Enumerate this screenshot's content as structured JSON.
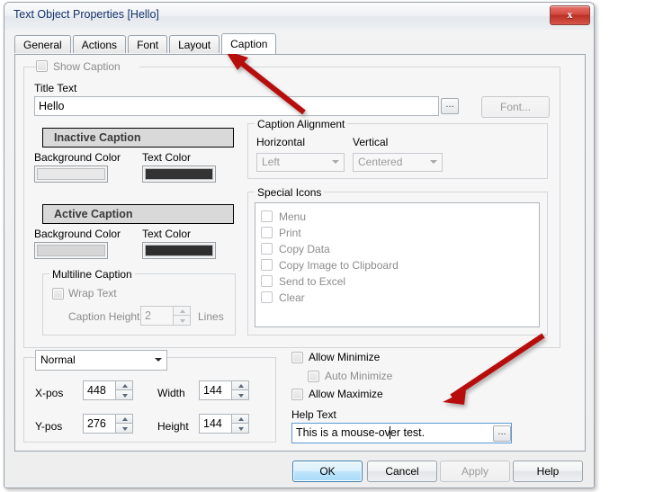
{
  "window": {
    "title": "Text Object Properties [Hello]",
    "close_label": "x"
  },
  "tabs": [
    {
      "label": "General",
      "active": false
    },
    {
      "label": "Actions",
      "active": false
    },
    {
      "label": "Font",
      "active": false
    },
    {
      "label": "Layout",
      "active": false
    },
    {
      "label": "Caption",
      "active": true
    }
  ],
  "caption_tab": {
    "show_caption": {
      "label": "Show Caption",
      "checked": false,
      "enabled": false
    },
    "title_text": {
      "label": "Title Text",
      "value": "Hello",
      "browse_label": "..."
    },
    "font_button": {
      "label": "Font...",
      "enabled": false
    },
    "inactive_caption": {
      "preview_text": "Inactive Caption",
      "background_label": "Background Color",
      "text_label": "Text Color",
      "background_color": "#e8e8e8",
      "text_color": "#333333"
    },
    "active_caption": {
      "preview_text": "Active Caption",
      "background_label": "Background Color",
      "text_label": "Text Color",
      "background_color": "#d6d6d6",
      "text_color": "#2e2e2e"
    },
    "multiline": {
      "legend": "Multiline Caption",
      "wrap_text_label": "Wrap Text",
      "wrap_text_checked": false,
      "caption_height_label": "Caption Height",
      "caption_height_value": "2",
      "lines_label": "Lines"
    },
    "alignment": {
      "legend": "Caption Alignment",
      "horizontal_label": "Horizontal",
      "horizontal_value": "Left",
      "vertical_label": "Vertical",
      "vertical_value": "Centered"
    },
    "special_icons": {
      "legend": "Special Icons",
      "items": [
        {
          "label": "Menu",
          "checked": false
        },
        {
          "label": "Print",
          "checked": false
        },
        {
          "label": "Copy Data",
          "checked": false
        },
        {
          "label": "Copy Image to Clipboard",
          "checked": false
        },
        {
          "label": "Send to Excel",
          "checked": false
        },
        {
          "label": "Clear",
          "checked": false
        }
      ]
    }
  },
  "position_panel": {
    "mode_value": "Normal",
    "xpos_label": "X-pos",
    "xpos_value": "448",
    "ypos_label": "Y-pos",
    "ypos_value": "276",
    "width_label": "Width",
    "width_value": "144",
    "height_label": "Height",
    "height_value": "144"
  },
  "window_options": {
    "allow_minimize": {
      "label": "Allow Minimize",
      "checked": false
    },
    "auto_minimize": {
      "label": "Auto Minimize",
      "checked": false,
      "enabled": false
    },
    "allow_maximize": {
      "label": "Allow Maximize",
      "checked": false
    },
    "help_text_label": "Help Text",
    "help_text_value": "This is a mouse-over test.",
    "help_browse_label": "..."
  },
  "dialog_buttons": [
    {
      "label": "OK",
      "style": "default"
    },
    {
      "label": "Cancel",
      "style": "normal"
    },
    {
      "label": "Apply",
      "style": "disabled"
    },
    {
      "label": "Help",
      "style": "normal"
    }
  ],
  "annotations": {
    "color": "#b80f0a",
    "arrow_1_target": "caption-tab",
    "arrow_2_target": "help-text-field"
  }
}
